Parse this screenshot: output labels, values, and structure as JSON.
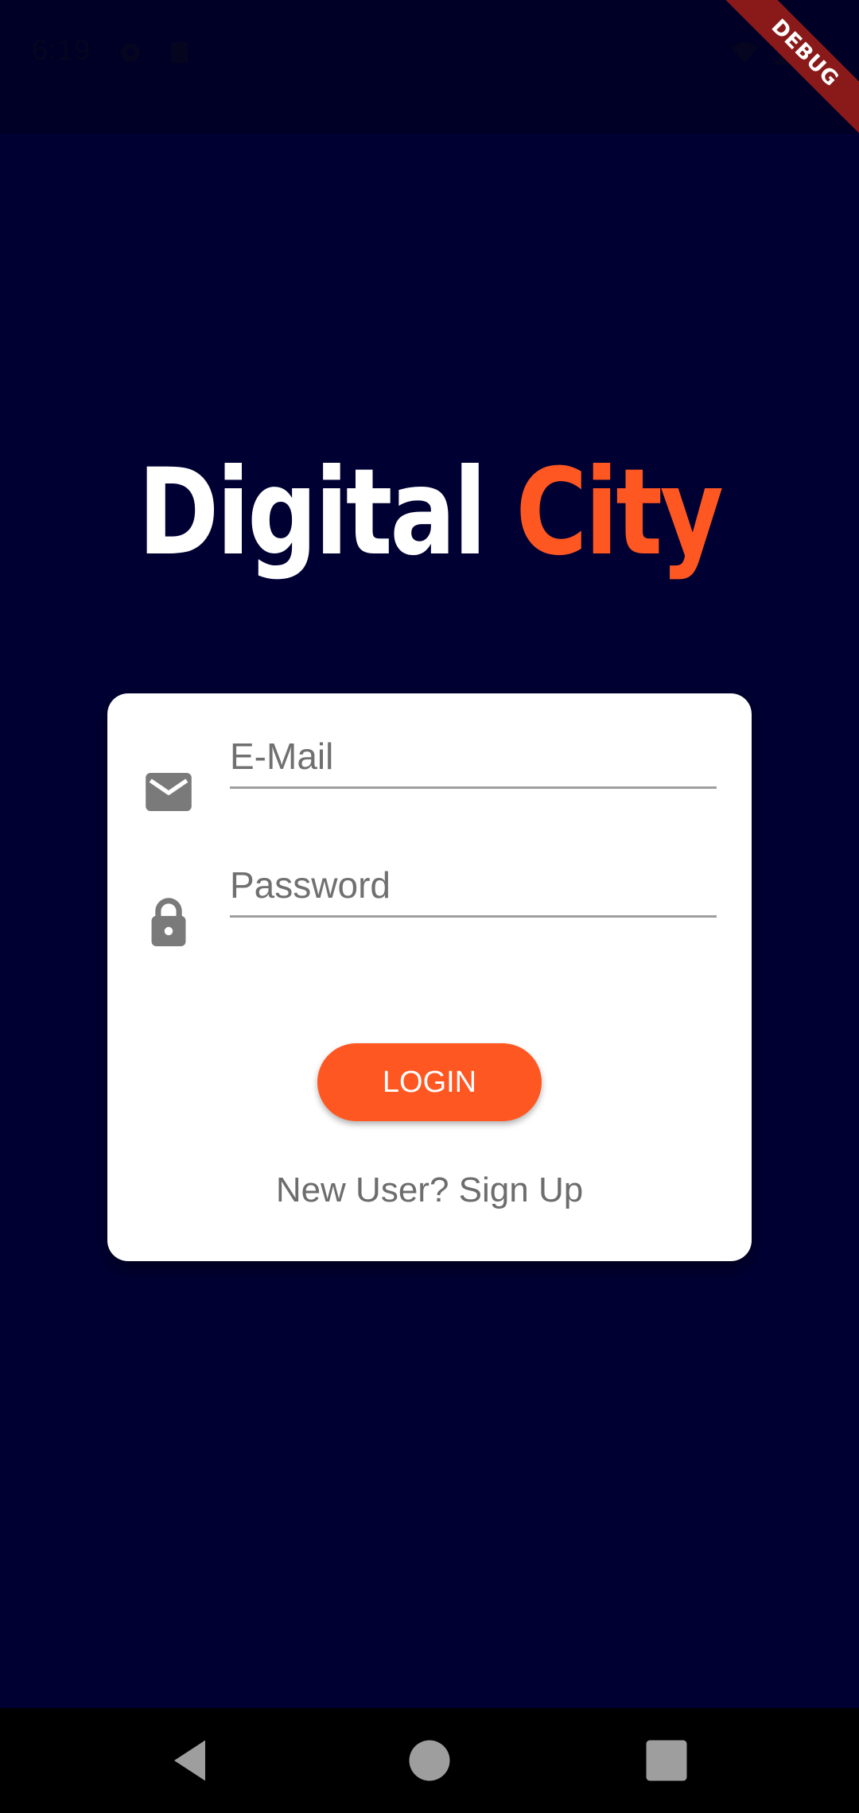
{
  "status_bar": {
    "time": "6:19"
  },
  "debug_banner": {
    "label": "DEBUG"
  },
  "title": {
    "part1": "Digital ",
    "part2": "City"
  },
  "login_form": {
    "email_placeholder": "E-Mail",
    "password_placeholder": "Password",
    "login_label": "LOGIN",
    "signup_label": "New User? Sign Up"
  },
  "icons": {
    "email": "email-icon",
    "password": "lock-icon"
  },
  "colors": {
    "background": "#000033",
    "accent": "#ff5722",
    "card": "#ffffff"
  }
}
